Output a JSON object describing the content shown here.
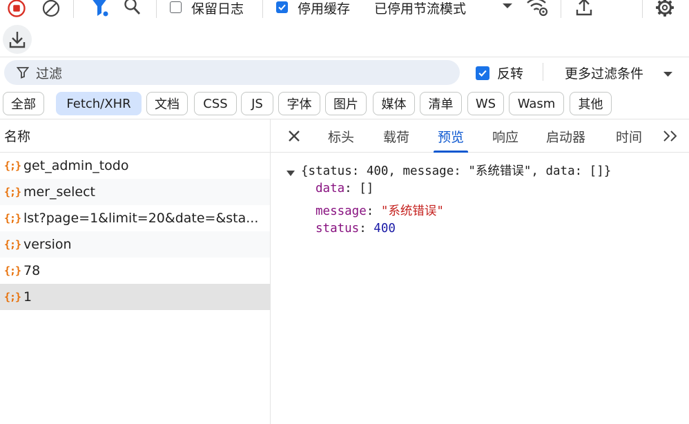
{
  "toolbar": {
    "preserve_log_label": "保留日志",
    "preserve_log_checked": false,
    "disable_cache_label": "停用缓存",
    "disable_cache_checked": true,
    "throttle_value": "已停用节流模式"
  },
  "filter": {
    "placeholder": "过滤",
    "invert_label": "反转",
    "invert_checked": true,
    "more_filters_label": "更多过滤条件"
  },
  "type_chips": [
    {
      "label": "全部",
      "active": false
    },
    {
      "label": "Fetch/XHR",
      "active": true
    },
    {
      "label": "文档",
      "active": false
    },
    {
      "label": "CSS",
      "active": false
    },
    {
      "label": "JS",
      "active": false
    },
    {
      "label": "字体",
      "active": false
    },
    {
      "label": "图片",
      "active": false
    },
    {
      "label": "媒体",
      "active": false
    },
    {
      "label": "清单",
      "active": false
    },
    {
      "label": "WS",
      "active": false
    },
    {
      "label": "Wasm",
      "active": false
    },
    {
      "label": "其他",
      "active": false
    }
  ],
  "requests": {
    "column_header": "名称",
    "items": [
      {
        "name": "get_admin_todo",
        "icon": "{;}"
      },
      {
        "name": "mer_select",
        "icon": "{;}"
      },
      {
        "name": "lst?page=1&limit=20&date=&sta...",
        "icon": "{;}"
      },
      {
        "name": "version",
        "icon": "{;}"
      },
      {
        "name": "78",
        "icon": "{;}"
      },
      {
        "name": "1",
        "icon": "{;}",
        "selected": true
      }
    ]
  },
  "detail_tabs": [
    {
      "label": "标头",
      "active": false
    },
    {
      "label": "载荷",
      "active": false
    },
    {
      "label": "预览",
      "active": true
    },
    {
      "label": "响应",
      "active": false
    },
    {
      "label": "启动器",
      "active": false
    },
    {
      "label": "时间",
      "active": false
    }
  ],
  "preview": {
    "summary": "{status: 400, message: \"系统错误\", data: []}",
    "fields": [
      {
        "key": "data",
        "value": "[]",
        "kind": "plain"
      },
      {
        "key": "message",
        "value": "\"系统错误\"",
        "kind": "string"
      },
      {
        "key": "status",
        "value": "400",
        "kind": "number"
      }
    ]
  },
  "colors": {
    "accent": "#0b57d0",
    "record_red": "#d93025",
    "xhr_orange": "#e8710a",
    "active_chip_bg": "#d3e3fd"
  }
}
